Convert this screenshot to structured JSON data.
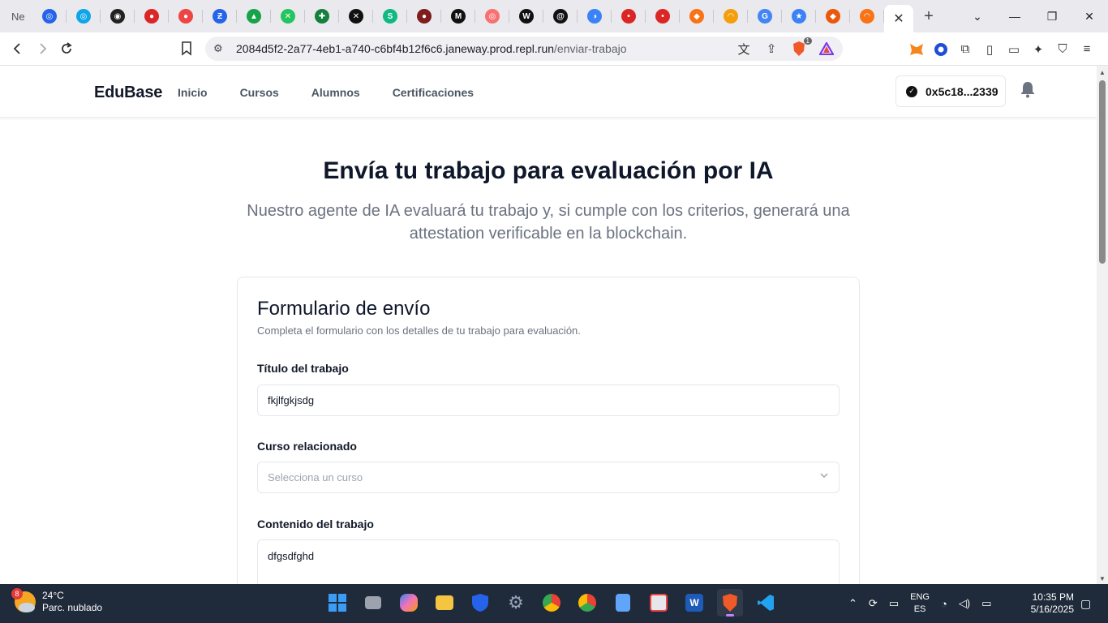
{
  "browser": {
    "first_tab_label": "Ne",
    "active_tab_close": "✕",
    "url_host": "2084d5f2-2a77-4eb1-a740-c6bf4b12f6c6.janeway.prod.repl.run",
    "url_path": "/enviar-trabajo",
    "brave_badge": "1",
    "tab_favicons": [
      {
        "icon": "blue-orb-icon",
        "color": "#2563eb",
        "glyph": "◎"
      },
      {
        "icon": "blue-orb-icon",
        "color": "#0ea5e9",
        "glyph": "◎"
      },
      {
        "icon": "dark-gear-icon",
        "color": "#222222",
        "glyph": "◉"
      },
      {
        "icon": "red-circle-icon",
        "color": "#dc2626",
        "glyph": "●"
      },
      {
        "icon": "red-circle-icon",
        "color": "#ef4444",
        "glyph": "●"
      },
      {
        "icon": "blue-link-icon",
        "color": "#2563eb",
        "glyph": "Ƶ"
      },
      {
        "icon": "green-triangle-icon",
        "color": "#16a34a",
        "glyph": "▲"
      },
      {
        "icon": "green-x-icon",
        "color": "#22c55e",
        "glyph": "✕"
      },
      {
        "icon": "green-cross-icon",
        "color": "#15803d",
        "glyph": "✚"
      },
      {
        "icon": "dark-x-icon",
        "color": "#111111",
        "glyph": "✕"
      },
      {
        "icon": "green-swirl-icon",
        "color": "#10b981",
        "glyph": "S"
      },
      {
        "icon": "dark-red-icon",
        "color": "#7f1d1d",
        "glyph": "●"
      },
      {
        "icon": "m-logo-icon",
        "color": "#111111",
        "glyph": "M"
      },
      {
        "icon": "pink-circle-icon",
        "color": "#f87171",
        "glyph": "◎"
      },
      {
        "icon": "w-logo-icon",
        "color": "#111111",
        "glyph": "W"
      },
      {
        "icon": "openai-icon",
        "color": "#111111",
        "glyph": "@"
      },
      {
        "icon": "colorful-orb-icon",
        "color": "#3b82f6",
        "glyph": "◑"
      },
      {
        "icon": "dot-circle-icon",
        "color": "#dc2626",
        "glyph": "•"
      },
      {
        "icon": "dot-circle-icon",
        "color": "#dc2626",
        "glyph": "•"
      },
      {
        "icon": "metamask-fox-icon",
        "color": "#f97316",
        "glyph": "◆"
      },
      {
        "icon": "rainbow-icon",
        "color": "#f59e0b",
        "glyph": "◠"
      },
      {
        "icon": "google-icon",
        "color": "#4285f4",
        "glyph": "G"
      },
      {
        "icon": "blue-star-icon",
        "color": "#3b82f6",
        "glyph": "★"
      },
      {
        "icon": "metamask-fox-icon",
        "color": "#ea580c",
        "glyph": "◆"
      },
      {
        "icon": "rainbow-icon",
        "color": "#f97316",
        "glyph": "◠"
      }
    ]
  },
  "app": {
    "brand": "EduBase",
    "nav": [
      "Inicio",
      "Cursos",
      "Alumnos",
      "Certificaciones"
    ],
    "wallet_address": "0x5c18...2339"
  },
  "page": {
    "title": "Envía tu trabajo para evaluación por IA",
    "subtitle": "Nuestro agente de IA evaluará tu trabajo y, si cumple con los criterios, generará una attestation verificable en la blockchain."
  },
  "form": {
    "title": "Formulario de envío",
    "description": "Completa el formulario con los detalles de tu trabajo para evaluación.",
    "title_label": "Título del trabajo",
    "title_value": "fkjlfgkjsdg",
    "course_label": "Curso relacionado",
    "course_placeholder": "Selecciona un curso",
    "content_label": "Contenido del trabajo",
    "content_value": "dfgsdfghd"
  },
  "taskbar": {
    "weather_temp": "24°C",
    "weather_desc": "Parc. nublado",
    "weather_badge": "8",
    "lang_primary": "ENG",
    "lang_secondary": "ES",
    "time": "10:35 PM",
    "date": "5/16/2025"
  },
  "colors": {
    "accent_dark": "#0f172a",
    "muted_text": "#6b7280",
    "border": "#e5e7eb"
  }
}
